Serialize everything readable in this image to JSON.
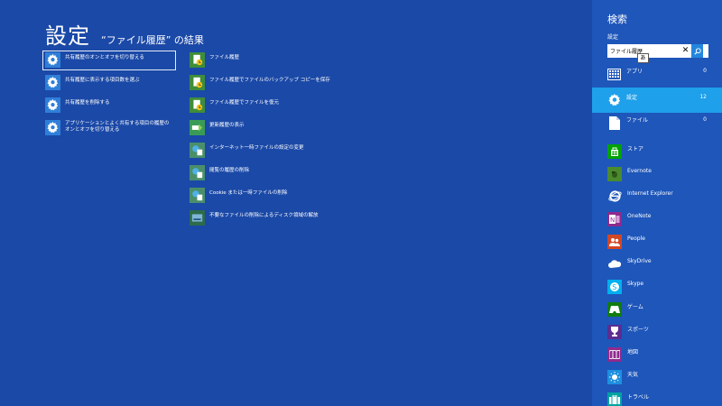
{
  "main": {
    "title": "設定",
    "subtitle": "“ファイル履歴” の結果",
    "left_results": [
      {
        "label": "共有履歴のオンとオフを切り替える",
        "icon": "gear-icon"
      },
      {
        "label": "共有履歴に表示する項目数を選ぶ",
        "icon": "gear-icon"
      },
      {
        "label": "共有履歴を削除する",
        "icon": "gear-icon"
      },
      {
        "label": "アプリケーションとよく共有する項目の履歴のオンとオフを切り替える",
        "icon": "gear-icon"
      }
    ],
    "right_results": [
      {
        "label": "ファイル履歴",
        "icon": "file-history-icon"
      },
      {
        "label": "ファイル履歴でファイルのバックアップ コピーを保存",
        "icon": "file-history-icon"
      },
      {
        "label": "ファイル履歴でファイルを復元",
        "icon": "file-history-icon"
      },
      {
        "label": "更新履歴の表示",
        "icon": "update-history-icon"
      },
      {
        "label": "インターネット一時ファイルの設定の変更",
        "icon": "internet-settings-icon"
      },
      {
        "label": "閲覧の履歴の削除",
        "icon": "internet-settings-icon"
      },
      {
        "label": "Cookie または一時ファイルの削除",
        "icon": "internet-settings-icon"
      },
      {
        "label": "不要なファイルの削除によるディスク領域の解放",
        "icon": "disk-cleanup-icon"
      }
    ]
  },
  "charm": {
    "title": "検索",
    "scope_label": "設定",
    "search_value": "ファイル履歴",
    "ime_indicator": "あ",
    "scopes": [
      {
        "label": "アプリ",
        "count": "0",
        "icon": "apps-icon"
      },
      {
        "label": "設定",
        "count": "12",
        "icon": "settings-gear-icon"
      },
      {
        "label": "ファイル",
        "count": "0",
        "icon": "file-icon"
      }
    ],
    "apps": [
      {
        "label": "ストア",
        "icon": "store-icon",
        "color": "#00a300"
      },
      {
        "label": "Evernote",
        "icon": "evernote-icon",
        "color": "#4b8a2d"
      },
      {
        "label": "Internet Explorer",
        "icon": "internet-explorer-icon",
        "color": "#1e56ba"
      },
      {
        "label": "OneNote",
        "icon": "onenote-icon",
        "color": "#8e2b8d"
      },
      {
        "label": "People",
        "icon": "people-icon",
        "color": "#d24726"
      },
      {
        "label": "SkyDrive",
        "icon": "skydrive-icon",
        "color": "#1e56ba"
      },
      {
        "label": "Skype",
        "icon": "skype-icon",
        "color": "#00aff0"
      },
      {
        "label": "ゲーム",
        "icon": "games-icon",
        "color": "#107c10"
      },
      {
        "label": "スポーツ",
        "icon": "sports-icon",
        "color": "#5c2d91"
      },
      {
        "label": "地図",
        "icon": "maps-icon",
        "color": "#8e2b8d"
      },
      {
        "label": "天気",
        "icon": "weather-icon",
        "color": "#1e8fe0"
      },
      {
        "label": "トラベル",
        "icon": "travel-icon",
        "color": "#00a3a3"
      }
    ]
  }
}
